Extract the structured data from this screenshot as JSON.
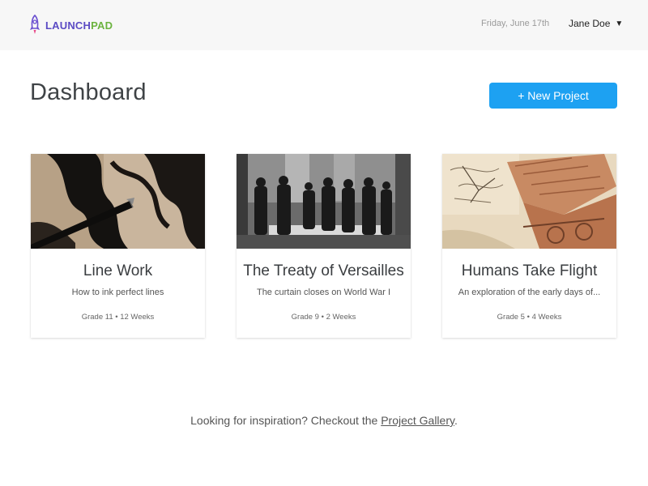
{
  "header": {
    "logo_part1": "LAUNCH",
    "logo_part2": "PAD",
    "date": "Friday, June 17th",
    "user_name": "Jane Doe",
    "user_caret": "▼"
  },
  "main": {
    "title": "Dashboard",
    "new_project_label": "+ New Project"
  },
  "projects": [
    {
      "title": "Line Work",
      "subtitle": "How to ink perfect lines",
      "meta": "Grade 11 • 12 Weeks",
      "image": "ink-pen-drawing"
    },
    {
      "title": "The Treaty of Versailles",
      "subtitle": "The curtain closes on World War I",
      "meta": "Grade 9 • 2 Weeks",
      "image": "historical-group-photo"
    },
    {
      "title": "Humans Take Flight",
      "subtitle": "An exploration of the early days of...",
      "meta": "Grade 5 • 4 Weeks",
      "image": "flying-machine-sketch"
    }
  ],
  "footer": {
    "prefix": "Looking for inspiration? Checkout the ",
    "link": "Project Gallery",
    "suffix": "."
  },
  "colors": {
    "accent": "#1da1f2",
    "logo_purple": "#5b4bc4",
    "logo_green": "#6cb33f",
    "header_bg": "#f7f7f7"
  }
}
